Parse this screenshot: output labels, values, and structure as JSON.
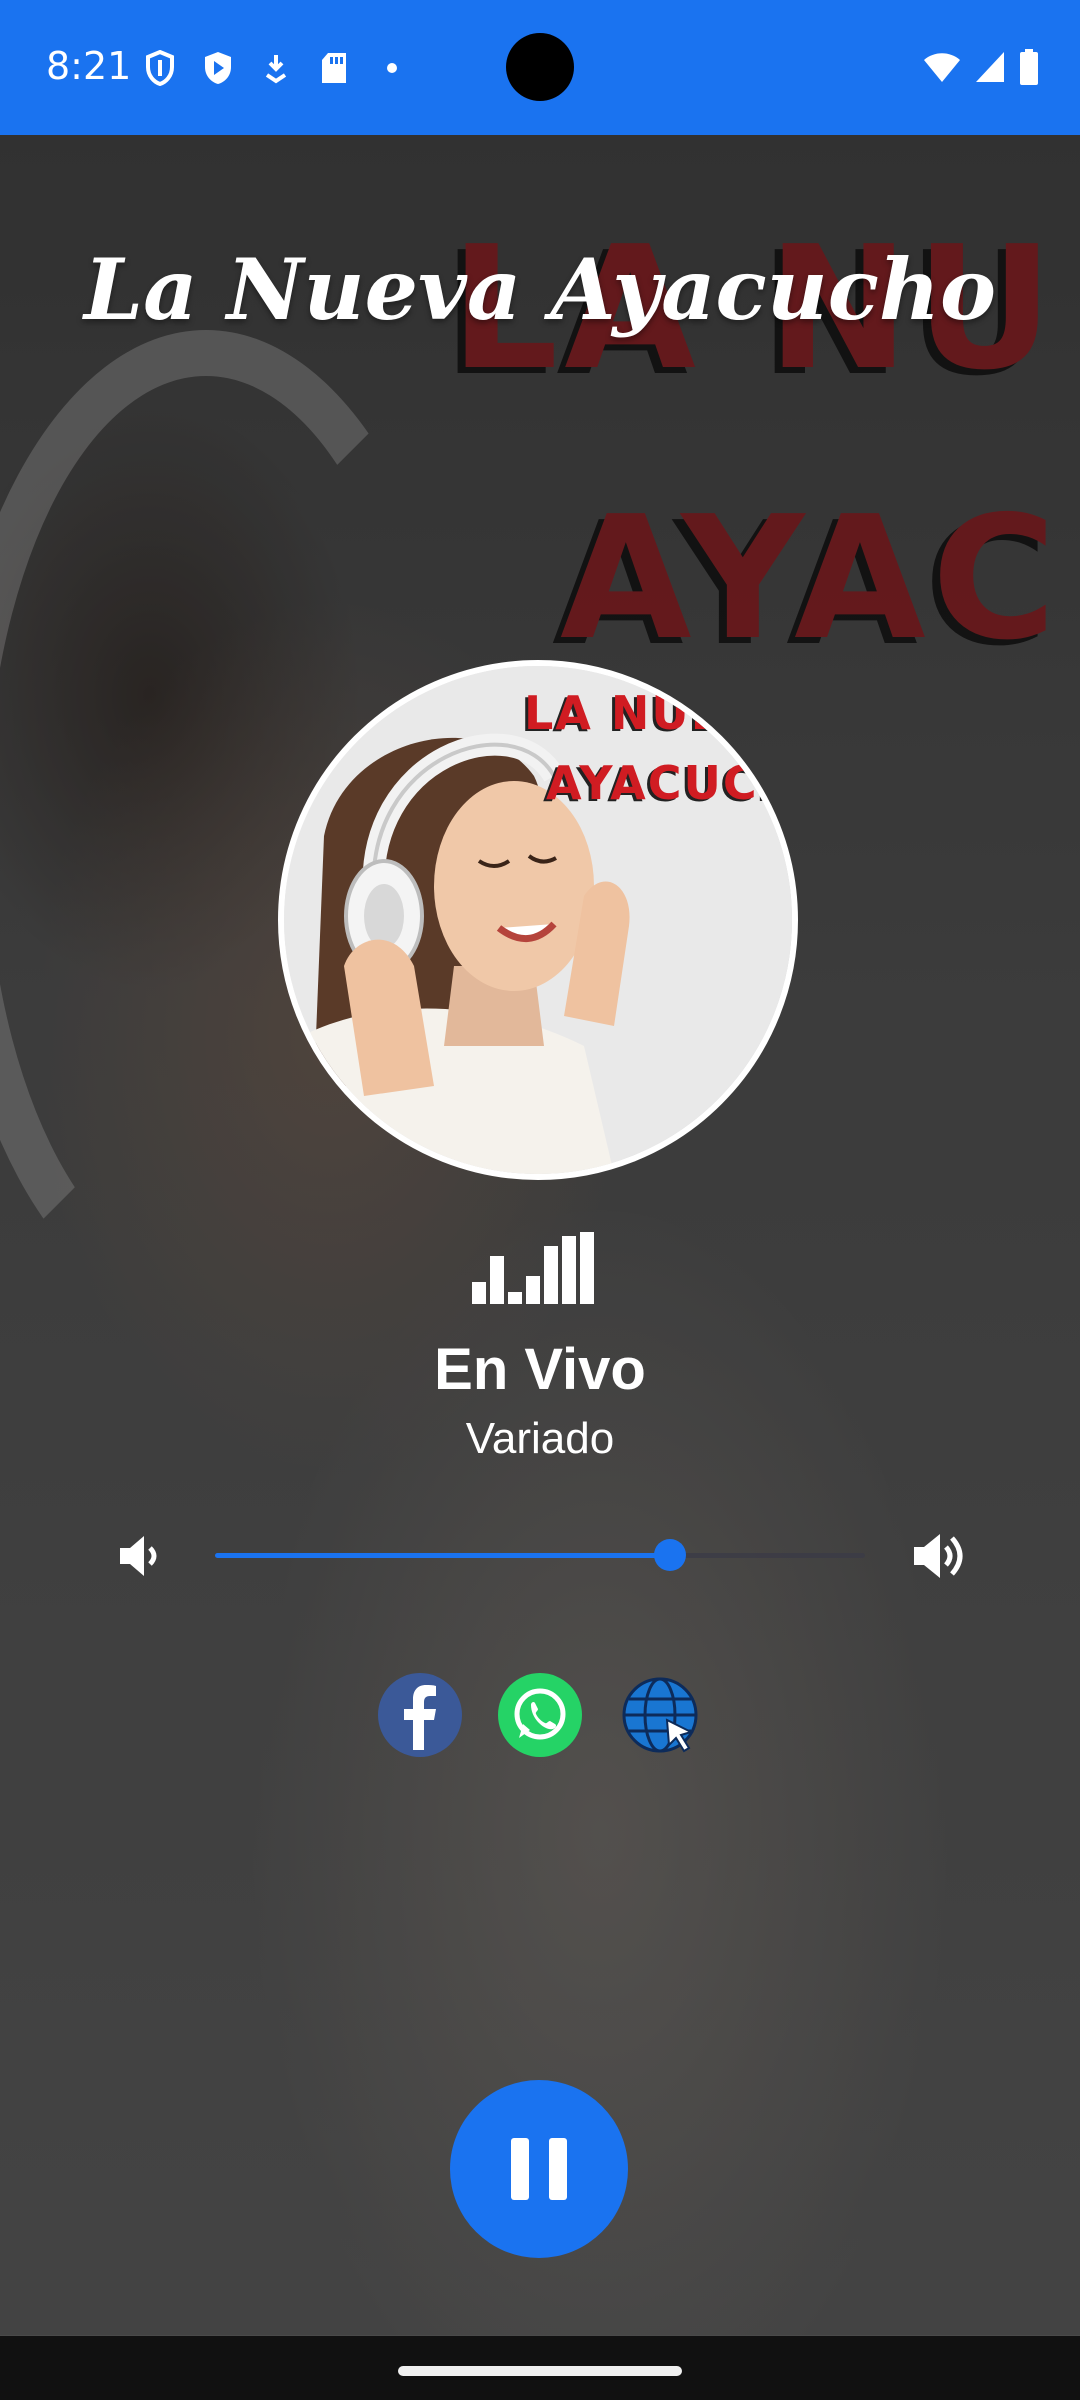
{
  "status_bar": {
    "time": "8:21",
    "left_icons": [
      "shield-icon",
      "play-protect-icon",
      "download-icon",
      "sd-card-icon",
      "dot-icon"
    ],
    "right_icons": [
      "wifi-icon",
      "signal-icon",
      "battery-icon"
    ],
    "accent_color": "#1a73f0"
  },
  "station": {
    "title": "La Nueva Ayacucho"
  },
  "background_art": {
    "word_1": "LA NU",
    "word_2": "AYAC"
  },
  "cover_art": {
    "word_1": "LA NUE",
    "word_2": "AYACUCH"
  },
  "now_playing": {
    "title": "En Vivo",
    "genre": "Variado",
    "equalizer_icon": "equalizer-icon"
  },
  "volume": {
    "level": 0.7,
    "low_icon": "volume-low-icon",
    "high_icon": "volume-high-icon",
    "fill_color": "#1a73f0"
  },
  "social": {
    "buttons": [
      {
        "name": "facebook",
        "icon": "facebook-icon",
        "color": "#3b5998"
      },
      {
        "name": "whatsapp",
        "icon": "whatsapp-icon",
        "color": "#25d366"
      },
      {
        "name": "website",
        "icon": "globe-cursor-icon",
        "color": "#1565c0"
      }
    ]
  },
  "player": {
    "state": "playing",
    "control_icon": "pause-icon",
    "button_color": "#1a73f0"
  }
}
